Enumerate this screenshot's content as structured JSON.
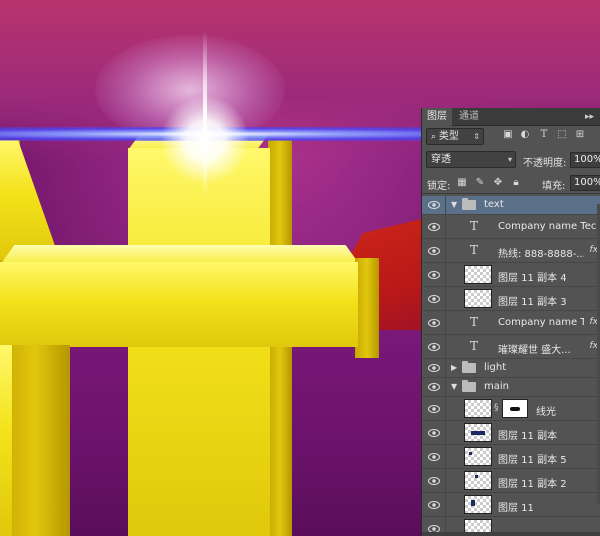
{
  "panel": {
    "tabs": [
      "图层",
      "通道"
    ],
    "filter": {
      "kind_label": "类型",
      "icons": [
        "image-filter-icon",
        "adjustment-filter-icon",
        "type-filter-icon",
        "shape-filter-icon",
        "smart-object-filter-icon"
      ]
    },
    "blend_mode": "穿透",
    "opacity_label": "不透明度:",
    "opacity_value": "100%",
    "lock_label": "锁定:",
    "lock_icons": [
      "lock-transparent-icon",
      "lock-paint-icon",
      "lock-position-icon",
      "lock-all-icon"
    ],
    "fill_label": "填充:",
    "fill_value": "100%"
  },
  "layers": [
    {
      "name": "text",
      "type": "group",
      "expanded": true,
      "selected": true
    },
    {
      "name": "Company name Tech...",
      "type": "text",
      "fx": false
    },
    {
      "name": "热线: 888-8888-...",
      "type": "text",
      "fx": true
    },
    {
      "name": "图层 11 副本 4",
      "type": "pixel",
      "fx": false
    },
    {
      "name": "图层 11 副本 3",
      "type": "pixel",
      "fx": false
    },
    {
      "name": "Company name T...",
      "type": "text",
      "fx": true
    },
    {
      "name": "璀璨耀世 盛大...",
      "type": "text",
      "fx": true
    },
    {
      "name": "light",
      "type": "group",
      "expanded": false
    },
    {
      "name": "main",
      "type": "group",
      "expanded": true
    },
    {
      "name": "线光",
      "type": "pixel-mask",
      "fx": false
    },
    {
      "name": "图层 11 副本",
      "type": "pixel",
      "fx": false
    },
    {
      "name": "图层 11 副本 5",
      "type": "pixel",
      "fx": false
    },
    {
      "name": "图层 11 副本 2",
      "type": "pixel",
      "fx": false
    },
    {
      "name": "图层 11",
      "type": "pixel",
      "fx": false
    }
  ],
  "colors": {
    "panel_bg": "#535353",
    "selected_row": "#5a6f88",
    "artwork_yellow": "#f3e21a",
    "artwork_purple": "#7a1a70",
    "flare_blue": "#4646ff"
  }
}
